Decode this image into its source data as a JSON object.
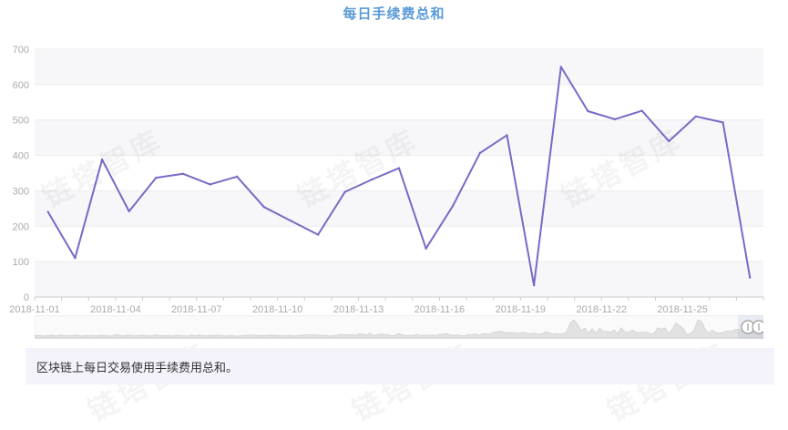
{
  "chart_data": {
    "type": "line",
    "title": "每日手续费总和",
    "x": [
      "2018-11-01",
      "2018-11-02",
      "2018-11-03",
      "2018-11-04",
      "2018-11-05",
      "2018-11-06",
      "2018-11-07",
      "2018-11-08",
      "2018-11-09",
      "2018-11-10",
      "2018-11-11",
      "2018-11-12",
      "2018-11-13",
      "2018-11-14",
      "2018-11-15",
      "2018-11-16",
      "2018-11-17",
      "2018-11-18",
      "2018-11-19",
      "2018-11-20",
      "2018-11-21",
      "2018-11-22",
      "2018-11-23",
      "2018-11-24",
      "2018-11-25",
      "2018-11-26",
      "2018-11-27"
    ],
    "series": [
      {
        "name": "",
        "color": "#7b68c8",
        "values": [
          240,
          110,
          388,
          242,
          337,
          348,
          318,
          340,
          254,
          215,
          176,
          297,
          332,
          364,
          137,
          258,
          407,
          457,
          33,
          650,
          525,
          502,
          526,
          440,
          510,
          493,
          55
        ]
      }
    ],
    "xtick_labels": [
      "2018-11-01",
      "2018-11-04",
      "2018-11-07",
      "2018-11-10",
      "2018-11-13",
      "2018-11-16",
      "2018-11-19",
      "2018-11-22",
      "2018-11-25"
    ],
    "ylim": [
      0,
      700
    ],
    "yticks": [
      0,
      100,
      200,
      300,
      400,
      500,
      600,
      700
    ],
    "grid": true,
    "legend": "none"
  },
  "description": "区块链上每日交易使用手续费用总和。",
  "watermark": "链塔智库",
  "colors": {
    "title": "#5b9bd5",
    "line": "#7b68c8",
    "band": "#f7f7f9",
    "description_bg": "#f4f2fb"
  }
}
